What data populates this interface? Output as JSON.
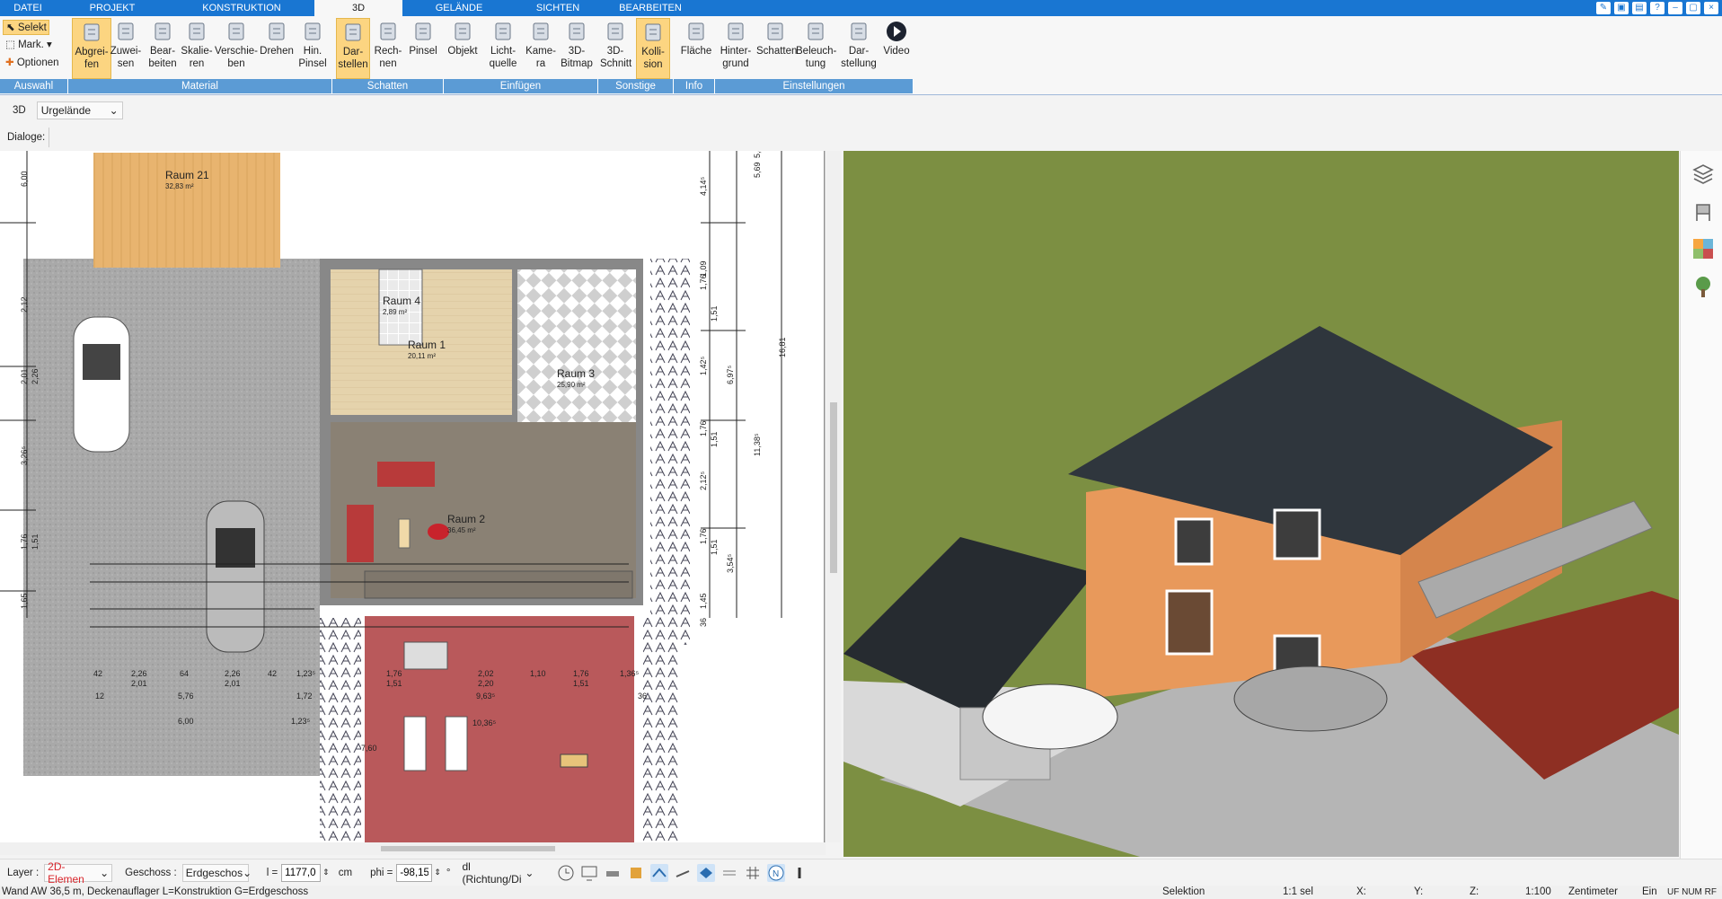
{
  "menu": {
    "tabs": [
      "DATEI",
      "PROJEKT",
      "KONSTRUKTION",
      "3D",
      "GELÄNDE",
      "SICHTEN",
      "BEARBEITEN"
    ],
    "active": "3D"
  },
  "ribbon": {
    "selekt": "Selekt",
    "mark": "Mark.",
    "optionen": "Optionen",
    "buttons": [
      {
        "l1": "Abgrei-",
        "l2": "fen"
      },
      {
        "l1": "Zuwei-",
        "l2": "sen"
      },
      {
        "l1": "Bear-",
        "l2": "beiten"
      },
      {
        "l1": "Skalie-",
        "l2": "ren"
      },
      {
        "l1": "Verschie-",
        "l2": "ben"
      },
      {
        "l1": "Drehen",
        "l2": ""
      },
      {
        "l1": "Hin.",
        "l2": "Pinsel"
      },
      {
        "l1": "Dar-",
        "l2": "stellen"
      },
      {
        "l1": "Rech-",
        "l2": "nen"
      },
      {
        "l1": "Pinsel",
        "l2": ""
      },
      {
        "l1": "Objekt",
        "l2": ""
      },
      {
        "l1": "Licht-",
        "l2": "quelle"
      },
      {
        "l1": "Kame-",
        "l2": "ra"
      },
      {
        "l1": "3D-",
        "l2": "Bitmap"
      },
      {
        "l1": "3D-",
        "l2": "Schnitt"
      },
      {
        "l1": "Kolli-",
        "l2": "sion"
      },
      {
        "l1": "Fläche",
        "l2": ""
      },
      {
        "l1": "Hinter-",
        "l2": "grund"
      },
      {
        "l1": "Schatten",
        "l2": ""
      },
      {
        "l1": "Beleuch-",
        "l2": "tung"
      },
      {
        "l1": "Dar-",
        "l2": "stellung"
      },
      {
        "l1": "Video",
        "l2": ""
      }
    ],
    "groups": [
      "Auswahl",
      "Material",
      "Schatten",
      "Einfügen",
      "Sonstige",
      "Info",
      "Einstellungen"
    ]
  },
  "bar3d": {
    "label": "3D",
    "select": "Urgelände"
  },
  "dialoge": "Dialoge:",
  "rooms": [
    {
      "name": "Raum 21",
      "area": "32,83 m²"
    },
    {
      "name": "Raum 4",
      "area": "2,89 m²"
    },
    {
      "name": "Raum 1",
      "area": "20,11 m²"
    },
    {
      "name": "Raum 3",
      "area": "25,90 m²"
    },
    {
      "name": "Raum 2",
      "area": "36,45 m²"
    }
  ],
  "dims": {
    "right": [
      "4,14⁵",
      "5,69",
      "5,44⁵",
      "1,09",
      "1,76",
      "1,51",
      "16,81",
      "1,42⁵",
      "6,97⁵",
      "11,38⁵",
      "1,76",
      "1,51",
      "2,12⁵",
      "1,76",
      "1,51",
      "3,54⁵",
      "1,45",
      "36"
    ],
    "left": [
      "6,00",
      "2,12",
      "2,01",
      "2,26",
      "3,26⁵",
      "1,76",
      "1,51",
      "1,65"
    ],
    "row1": [
      "42",
      "2,26",
      "64",
      "2,26",
      "42",
      "1,23⁵",
      "1,76",
      "2,02",
      "1,10",
      "1,76",
      "1,36⁵"
    ],
    "row1b": [
      "2,01",
      "2,01",
      "1,51",
      "2,20",
      "1,51"
    ],
    "row2": [
      "12",
      "5,76",
      "1,72",
      "9,63⁵",
      "36"
    ],
    "row3": [
      "6,00",
      "1,23⁵",
      "10,36⁵"
    ],
    "row4": [
      "7,60"
    ]
  },
  "toolbar": {
    "layer_label": "Layer :",
    "layer_value": "2D-Elemen",
    "geschoss_label": "Geschoss :",
    "geschoss_value": "Erdgeschos",
    "l_label": "l =",
    "l_value": "1177,0",
    "l_unit": "cm",
    "phi_label": "phi =",
    "phi_value": "-98,15",
    "phi_unit": "°",
    "dl_value": "dl (Richtung/Di"
  },
  "status": {
    "left": "Wand AW 36,5 m, Deckenauflager L=Konstruktion G=Erdgeschoss",
    "selektion": "Selektion",
    "sel": "1:1 sel",
    "x": "X:",
    "y": "Y:",
    "z": "Z:",
    "scale": "1:100",
    "unit": "Zentimeter",
    "ein": "Ein",
    "flags": "UF NUM RF"
  },
  "colors": {
    "accent": "#1976d2",
    "group": "#5b9bd5",
    "active_btn": "#fcd581",
    "wall_orange": "#e8995b",
    "roof": "#2f363d",
    "grass": "#7c8f42"
  }
}
